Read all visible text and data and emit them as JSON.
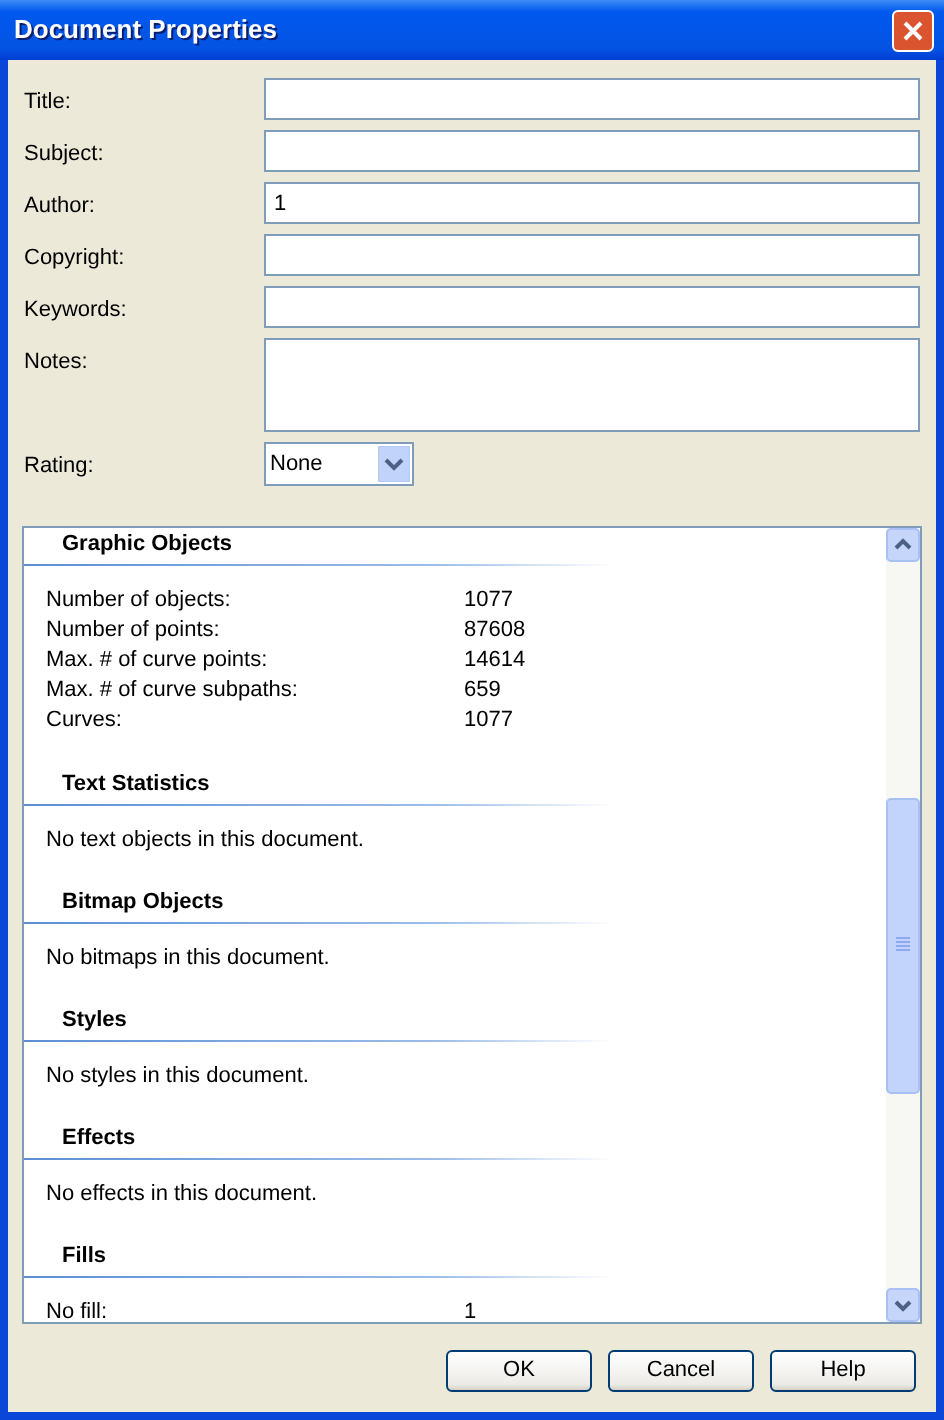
{
  "window": {
    "title": "Document Properties"
  },
  "fields": [
    {
      "kind": "text",
      "label": "Title:"
    },
    {
      "kind": "text",
      "label": "Subject:"
    },
    {
      "kind": "text",
      "label": "Author:",
      "value": "1"
    },
    {
      "kind": "text",
      "label": "Copyright:"
    },
    {
      "kind": "text",
      "label": "Keywords:"
    },
    {
      "kind": "multiline",
      "label": "Notes:"
    },
    {
      "kind": "dropdown",
      "label": "Rating:",
      "value": "None"
    }
  ],
  "sections": [
    {
      "kind": "rows",
      "title": "Graphic Objects",
      "rows": [
        {
          "label": "Number of objects:",
          "value": "1077"
        },
        {
          "label": "Number of points:",
          "value": "87608"
        },
        {
          "label": "Max. # of curve points:",
          "value": "14614"
        },
        {
          "label": "Max. # of curve subpaths:",
          "value": "659"
        },
        {
          "label": "Curves:",
          "value": "1077"
        }
      ]
    },
    {
      "kind": "message",
      "title": "Text Statistics",
      "message": "No text objects in this document."
    },
    {
      "kind": "message",
      "title": "Bitmap Objects",
      "message": "No bitmaps in this document."
    },
    {
      "kind": "message",
      "title": "Styles",
      "message": "No styles in this document."
    },
    {
      "kind": "message",
      "title": "Effects",
      "message": "No effects in this document."
    },
    {
      "kind": "rows",
      "title": "Fills",
      "rows": [
        {
          "label": "No fill:",
          "value": "1"
        }
      ]
    }
  ],
  "buttons": [
    "OK",
    "Cancel",
    "Help"
  ]
}
